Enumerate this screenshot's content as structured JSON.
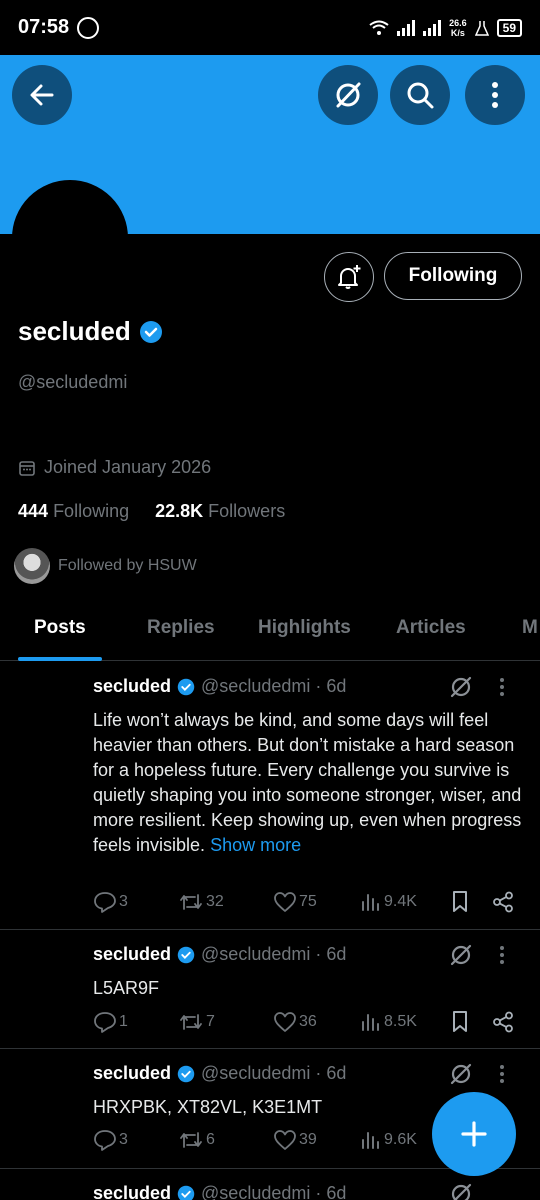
{
  "status_bar": {
    "time": "07:58",
    "speed_value": "26.6",
    "speed_unit": "K/s",
    "battery": "59"
  },
  "header": {
    "back_icon": "arrow-left-icon",
    "grok_icon": "grok-icon",
    "search_icon": "search-icon",
    "more_icon": "more-vertical-icon",
    "banner_color": "#1d9bf0"
  },
  "profile": {
    "name": "secluded",
    "handle": "@secludedmi",
    "joined": "Joined January 2026",
    "following_count": "444",
    "following_label": "Following",
    "followers_count": "22.8K",
    "followers_label": "Followers",
    "followed_by": "Followed by HSUW",
    "follow_button": "Following"
  },
  "tabs": [
    "Posts",
    "Replies",
    "Highlights",
    "Articles",
    "M"
  ],
  "posts": [
    {
      "name": "secluded",
      "meta": "@secludedmi · 6d",
      "text": "Life won’t always be kind, and some days will feel heavier than others. But don’t mistake a hard season for a hopeless future. Every challenge you survive is quietly shaping you into someone stronger, wiser, and more resilient. Keep showing up, even when progress feels invisible.",
      "more": "Show more",
      "replies": "3",
      "reposts": "32",
      "likes": "75",
      "views": "9.4K"
    },
    {
      "name": "secluded",
      "meta": "@secludedmi · 6d",
      "text": "L5AR9F",
      "replies": "1",
      "reposts": "7",
      "likes": "36",
      "views": "8.5K"
    },
    {
      "name": "secluded",
      "meta": "@secludedmi · 6d",
      "text": "HRXPBK, XT82VL, K3E1MT",
      "replies": "3",
      "reposts": "6",
      "likes": "39",
      "views": "9.6K"
    },
    {
      "name": "secluded",
      "meta": "@secludedmi · 6d"
    }
  ]
}
